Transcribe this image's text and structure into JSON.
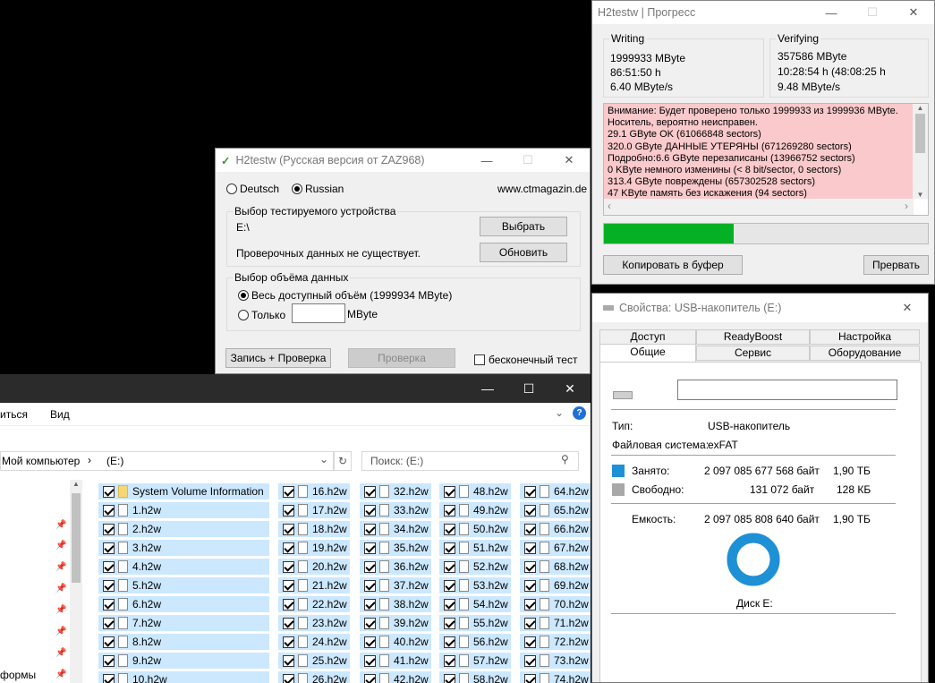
{
  "h2progress": {
    "title": "H2testw | Прогресс",
    "writing": {
      "label": "Writing",
      "size": "1999933 MByte",
      "time": "86:51:50 h",
      "speed": "6.40 MByte/s"
    },
    "verifying": {
      "label": "Verifying",
      "size": "357586 MByte",
      "time": "10:28:54 h (48:08:25 h",
      "speed": "9.48 MByte/s"
    },
    "log": [
      "Внимание: Будет проверено только 1999933 из 1999936 MByte.",
      "Носитель, вероятно неисправен.",
      "29.1 GByte OK (61066848 sectors)",
      "320.0 GByte ДАННЫЕ УТЕРЯНЫ (671269280 sectors)",
      "Подробно:6.6 GByte перезаписаны (13966752 sectors)",
      "0 KByte немного изменины (< 8 bit/sector, 0 sectors)",
      "313.4 GByte повреждены (657302528 sectors)",
      "47 KByte память без искажения (94 sectors)"
    ],
    "progress": 0.4,
    "copy_button": "Копировать в буфер",
    "abort_button": "Прервать",
    "colors": {
      "log_bg": "#f9c9cb",
      "progress": "#06b025"
    }
  },
  "h2main": {
    "title": "H2testw (Русская версия от ZAZ968)",
    "lang_de": "Deutsch",
    "lang_ru": "Russian",
    "site": "www.ctmagazin.de",
    "device_group": "Выбор тестируемого устройства",
    "device": "E:\\",
    "no_data": "Проверочных данных не существует.",
    "select_button": "Выбрать",
    "refresh_button": "Обновить",
    "volume_group": "Выбор объёма данных",
    "all_space": "Весь доступный объём (1999934 MByte)",
    "only": "Только",
    "mbyte": "MByte",
    "write_verify_button": "Запись + Проверка",
    "verify_button": "Проверка",
    "endless": "бесконечный тест"
  },
  "explorer": {
    "menu_share": "иться",
    "menu_view": "Вид",
    "breadcrumb_pc": "Мой компьютер",
    "breadcrumb_sep": "›",
    "breadcrumb_drive": "(E:)",
    "search_placeholder": "Поиск:  (E:)",
    "nav_bottom": "формы",
    "columns": [
      [
        "System Volume Information",
        "1.h2w",
        "2.h2w",
        "3.h2w",
        "4.h2w",
        "5.h2w",
        "6.h2w",
        "7.h2w",
        "8.h2w",
        "9.h2w",
        "10.h2w"
      ],
      [
        "16.h2w",
        "17.h2w",
        "18.h2w",
        "19.h2w",
        "20.h2w",
        "21.h2w",
        "22.h2w",
        "23.h2w",
        "24.h2w",
        "25.h2w",
        "26.h2w"
      ],
      [
        "32.h2w",
        "33.h2w",
        "34.h2w",
        "35.h2w",
        "36.h2w",
        "37.h2w",
        "38.h2w",
        "39.h2w",
        "40.h2w",
        "41.h2w",
        "42.h2w"
      ],
      [
        "48.h2w",
        "49.h2w",
        "50.h2w",
        "51.h2w",
        "52.h2w",
        "53.h2w",
        "54.h2w",
        "55.h2w",
        "56.h2w",
        "57.h2w",
        "58.h2w"
      ],
      [
        "64.h2w",
        "65.h2w",
        "66.h2w",
        "67.h2w",
        "68.h2w",
        "69.h2w",
        "70.h2w",
        "71.h2w",
        "72.h2w",
        "73.h2w",
        "74.h2w"
      ]
    ]
  },
  "props": {
    "title": "Свойства: USB-накопитель (E:)",
    "tabs_top": [
      "Доступ",
      "ReadyBoost",
      "Настройка"
    ],
    "tabs_bottom": [
      "Общие",
      "Сервис",
      "Оборудование"
    ],
    "type_label": "Тип:",
    "type_value": "USB-накопитель",
    "fs_label": "Файловая система:",
    "fs_value": "exFAT",
    "used_label": "Занято:",
    "used_bytes": "2 097 085 677 568 байт",
    "used_short": "1,90 ТБ",
    "free_label": "Свободно:",
    "free_bytes": "131 072 байт",
    "free_short": "128 КБ",
    "cap_label": "Емкость:",
    "cap_bytes": "2 097 085 808 640 байт",
    "cap_short": "1,90 ТБ",
    "disk_label": "Диск E:",
    "used_fraction": 0.99999,
    "colors": {
      "used": "#1e90d6",
      "free": "#a8a8a8"
    }
  }
}
